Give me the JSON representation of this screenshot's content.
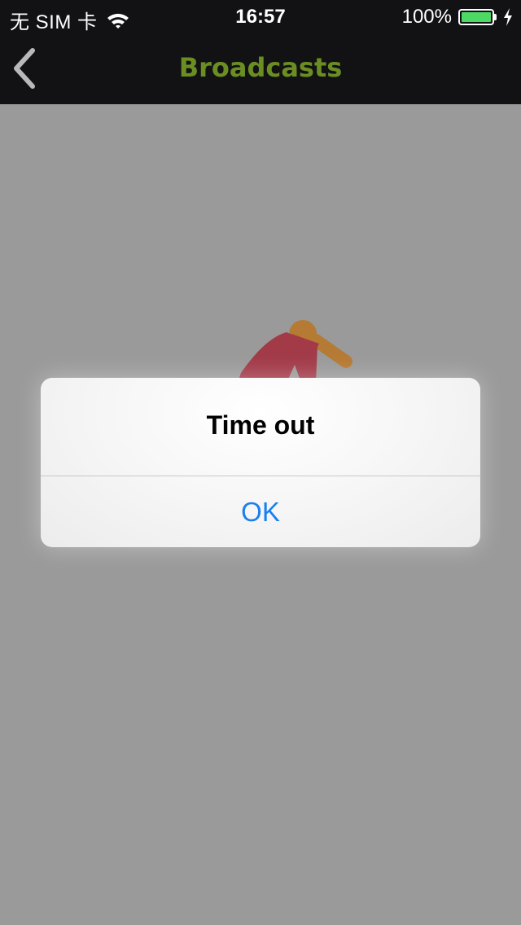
{
  "status_bar": {
    "carrier": "无 SIM 卡",
    "time": "16:57",
    "battery_percent": "100%",
    "battery_level": 1.0,
    "icons": [
      "wifi-icon",
      "battery-icon",
      "charging-bolt-icon"
    ],
    "battery_color": "#4cd964"
  },
  "nav": {
    "title": "Broadcasts",
    "title_color": "#6b8e23",
    "back_icon": "chevron-left-icon",
    "back_color": "#b9b9b9"
  },
  "content": {
    "background_color": "#9a9a9a",
    "illustration": "person-figure-icon"
  },
  "alert": {
    "title": "Time out",
    "button_label": "OK",
    "button_color": "#1a7ff0"
  }
}
